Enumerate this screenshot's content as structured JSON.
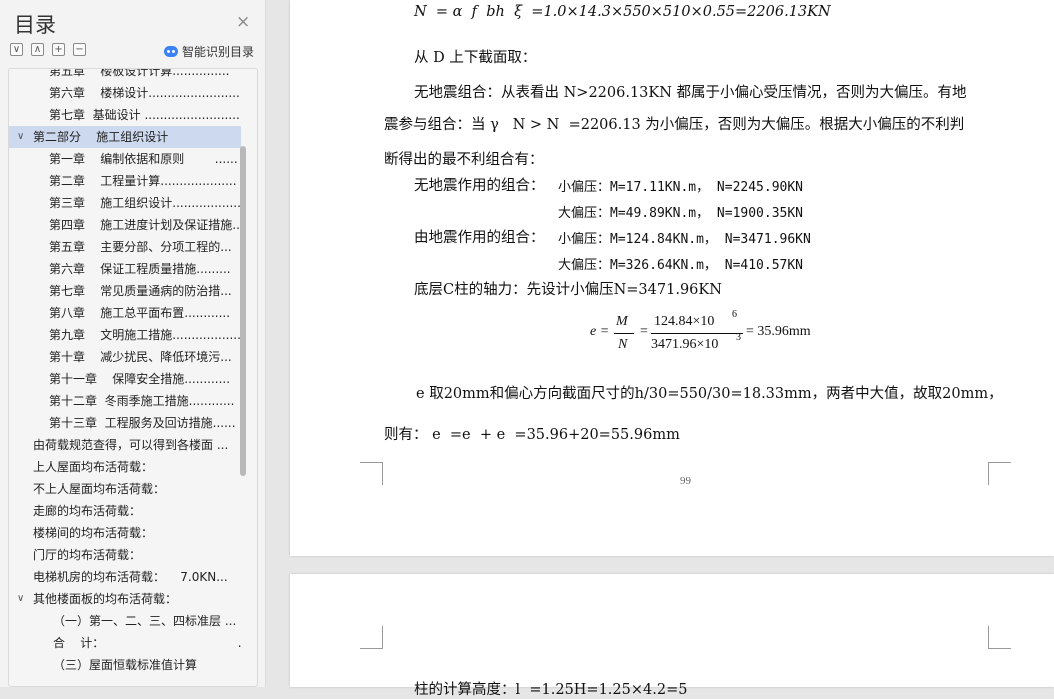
{
  "sidebar": {
    "title": "目录",
    "close": "×",
    "tools": [
      "∨",
      "∧",
      "+",
      "−"
    ],
    "ai_label": "智能识别目录",
    "items": [
      {
        "text": "第五章    楼板设计计算...............",
        "indent": 2
      },
      {
        "text": "第六章    楼梯设计........................",
        "indent": 2
      },
      {
        "text": "第七章  基础设计 .........................",
        "indent": 2
      },
      {
        "text": "第二部分    施工组织设计",
        "indent": 1,
        "arrow": "∨",
        "selected": true
      },
      {
        "text": "第一章    编制依据和原则        ......",
        "indent": 2
      },
      {
        "text": "第二章    工程量计算....................",
        "indent": 2
      },
      {
        "text": "第三章    施工组织设计..................",
        "indent": 2
      },
      {
        "text": "第四章    施工进度计划及保证措施...",
        "indent": 2
      },
      {
        "text": "第五章    主要分部、分项工程的...",
        "indent": 2
      },
      {
        "text": "第六章    保证工程质量措施.........",
        "indent": 2
      },
      {
        "text": "第七章    常见质量通病的防治措...",
        "indent": 2
      },
      {
        "text": "第八章    施工总平面布置............",
        "indent": 2
      },
      {
        "text": "第九章    文明施工措施..................",
        "indent": 2
      },
      {
        "text": "第十章    减少扰民、降低环境污...",
        "indent": 2
      },
      {
        "text": "第十一章    保障安全措施............",
        "indent": 2
      },
      {
        "text": "第十二章  冬雨季施工措施............",
        "indent": 2
      },
      {
        "text": "第十三章  工程服务及回访措施......",
        "indent": 2
      },
      {
        "text": "由荷载规范查得，可以得到各楼面 ...",
        "indent": 1
      },
      {
        "text": "上人屋面均布活荷载：",
        "indent": 1
      },
      {
        "text": "不上人屋面均布活荷载：",
        "indent": 1
      },
      {
        "text": "走廊的均布活荷载：",
        "indent": 1
      },
      {
        "text": "楼梯间的均布活荷载：",
        "indent": 1
      },
      {
        "text": "门厅的均布活荷载：",
        "indent": 1
      },
      {
        "text": "电梯机房的均布活荷载：    7.0KN...",
        "indent": 1
      },
      {
        "text": "其他楼面板的均布活荷载：",
        "indent": 1,
        "arrow": "∨"
      },
      {
        "text": "（一）第一、二、三、四标准层 ...",
        "indent": 3
      },
      {
        "text": "合    计：                                   ...",
        "indent": 3
      },
      {
        "text": "（三）屋面恒载标准值计算",
        "indent": 3
      }
    ]
  },
  "doc": {
    "formula_nb": "N  = α  f  bh  ξ  =1.0×14.3×550×510×0.55=2206.13KN",
    "line_section": "从 D 上下截面取：",
    "para1_a": "无地震组合：从表看出 N>2206.13KN 都属于小偏心受压情况，否则为大偏压。有地",
    "para1_b": "震参与组合：当 γ   N > N  =2206.13 为小偏压，否则为大偏压。根据大小偏压的不利判",
    "para1_c": "断得出的最不利组合有：",
    "combo1_label": "无地震作用的组合：",
    "combo1_small": "小偏压：M=17.11KN.m， N=2245.90KN",
    "combo1_large": "大偏压：M=49.89KN.m， N=1900.35KN",
    "combo2_label": "由地震作用的组合：",
    "combo2_small": "小偏压：M=124.84KN.m， N=3471.96KN",
    "combo2_large": "大偏压：M=326.64KN.m， N=410.57KN",
    "axial_line": "底层C柱的轴力：先设计小偏压N=3471.96KN",
    "eq_lhs": "e =",
    "eq_M": "M",
    "eq_N": "N",
    "eq_num": "124.84×10",
    "eq_num_exp": "6",
    "eq_den": "3471.96×10",
    "eq_den_exp": "3",
    "eq_result": "= 35.96mm",
    "ea_line": "e 取20mm和偏心方向截面尺寸的h/30=550/30=18.33mm，两者中大值，故取20mm，",
    "ei_line": "则有： e  =e  + e  =35.96+20=55.96mm",
    "page_number": "99",
    "next_page_partial": "柱的计算高度：l  =1.25H=1.25×4.2=5"
  }
}
